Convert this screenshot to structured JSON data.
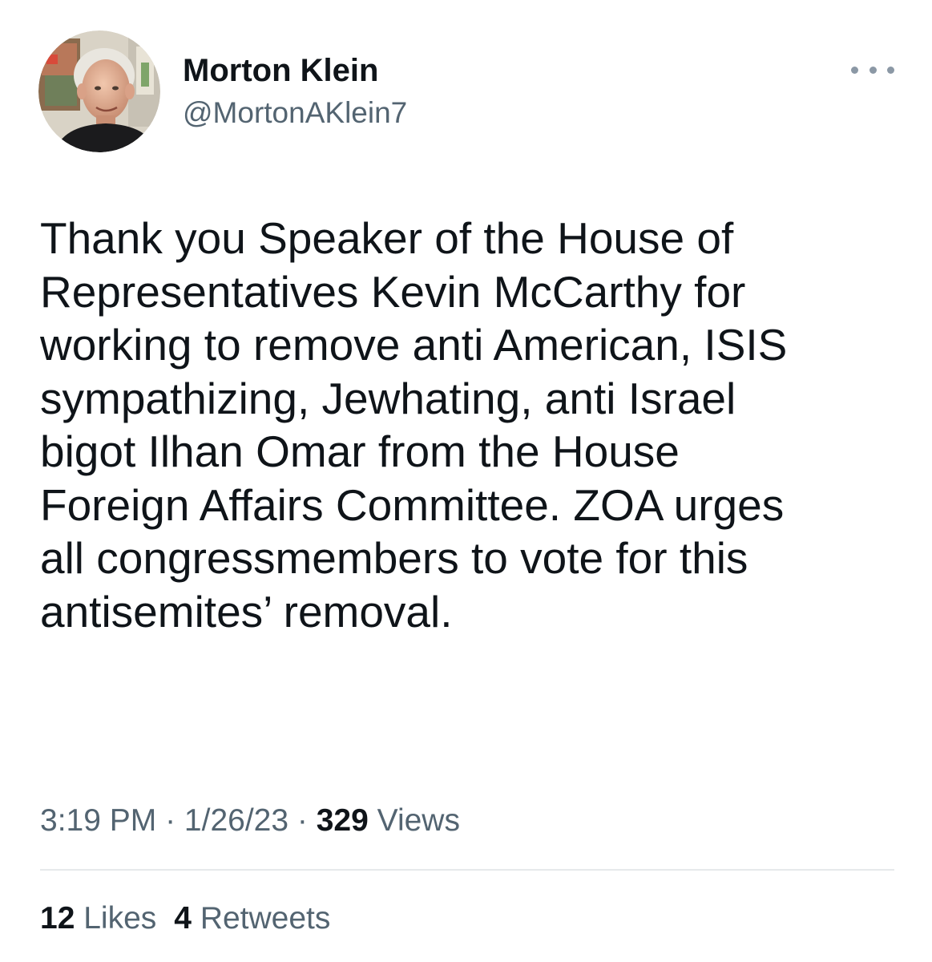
{
  "author": {
    "display_name": "Morton Klein",
    "handle": "@MortonAKlein7",
    "avatar_icon": "profile-photo"
  },
  "more_icon": "more-horizontal-icon",
  "tweet": {
    "lines": [
      "Thank you Speaker of the House of",
      "Representatives Kevin McCarthy for",
      "working to remove anti American, ISIS",
      "sympathizing, Jewhating, anti Israel",
      "bigot Ilhan Omar from the House",
      "Foreign Affairs Committee. ZOA urges",
      "all congressmembers to vote for this",
      "antisemites’ removal."
    ]
  },
  "meta": {
    "time": "3:19 PM",
    "sep1": " · ",
    "date": "1/26/23",
    "sep2": " · ",
    "views_count": "329",
    "views_label": " Views"
  },
  "stats": {
    "likes_count": "12",
    "likes_label": " Likes",
    "retweets_count": "4",
    "retweets_label": " Retweets"
  },
  "colors": {
    "text_primary": "#0f1419",
    "text_secondary": "#536471",
    "divider": "#e6e9eb"
  }
}
